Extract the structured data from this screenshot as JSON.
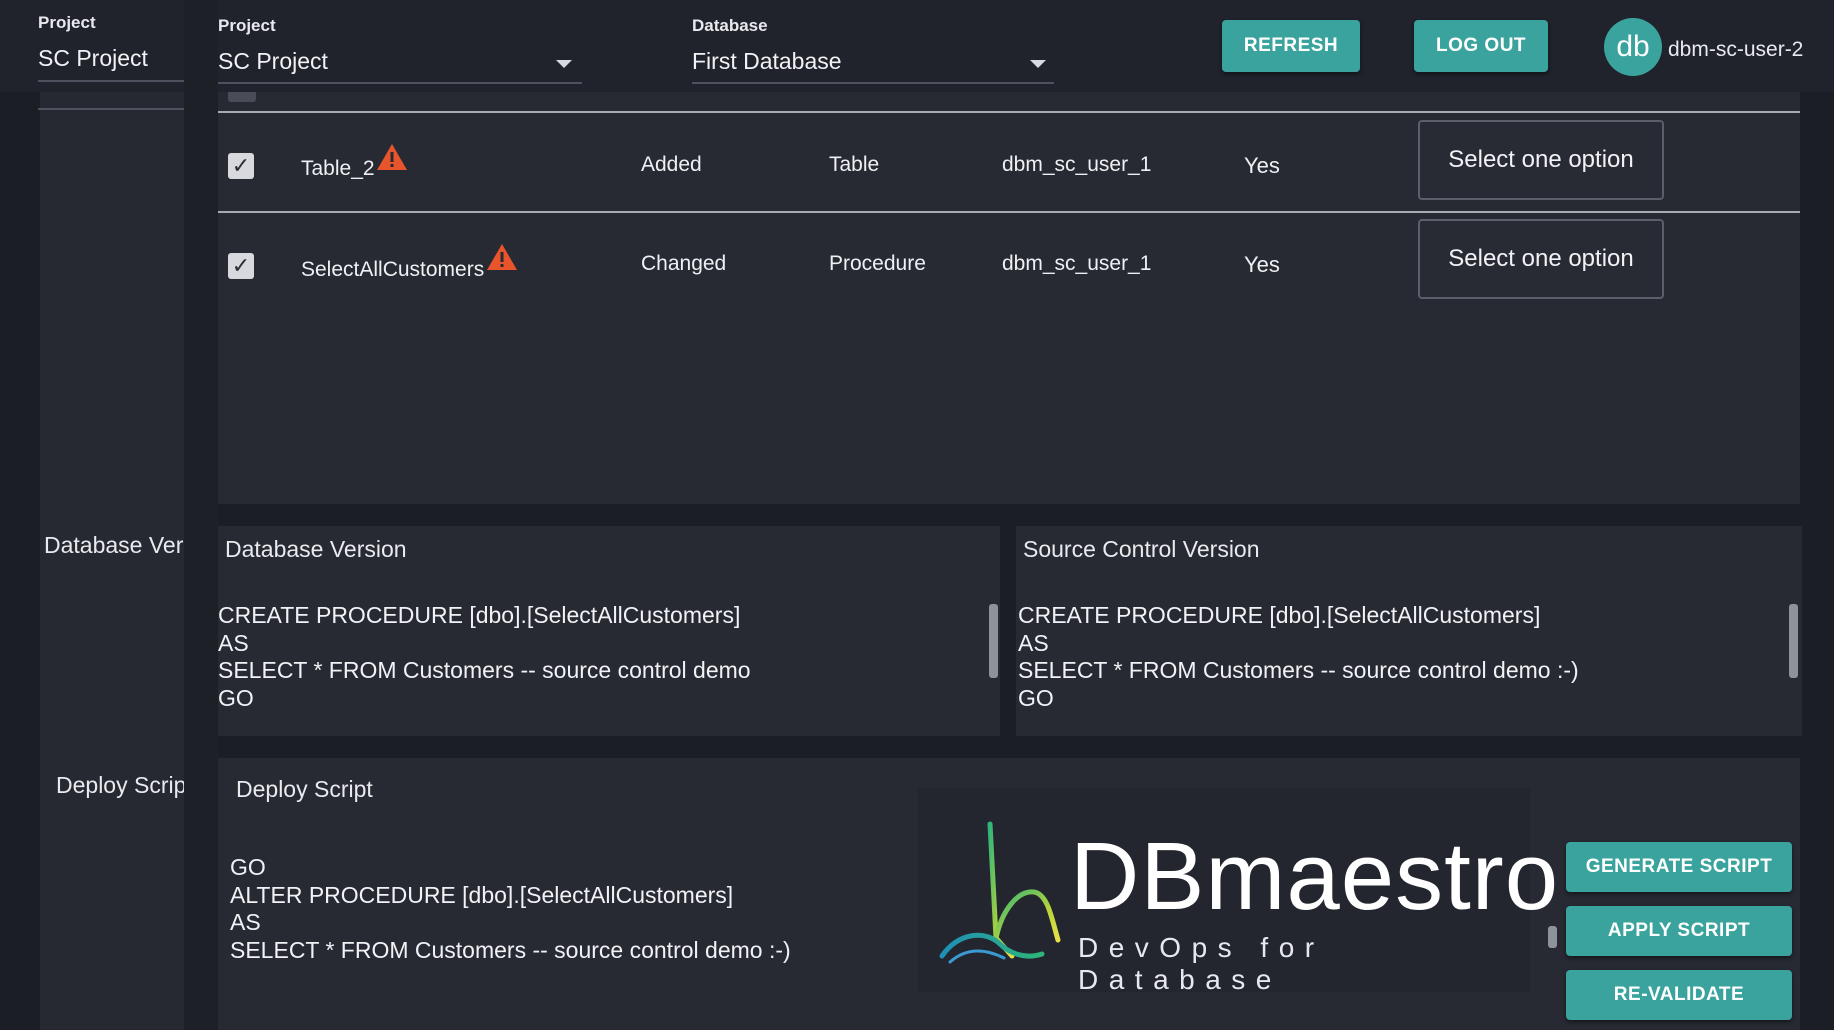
{
  "header": {
    "sidebar_project_label": "Project",
    "sidebar_project_value": "SC Project",
    "project_label": "Project",
    "project_value": "SC Project",
    "database_label": "Database",
    "database_value": "First Database",
    "refresh_label": "REFRESH",
    "logout_label": "LOG OUT",
    "avatar_initials": "db",
    "username": "dbm-sc-user-2"
  },
  "sidebar": {
    "db_version_label": "Database Ver",
    "deploy_script_label": "Deploy Scrip"
  },
  "table": {
    "rows": [
      {
        "checked": "✓",
        "object_name": "Table_2",
        "change_type": "Added",
        "object_type": "Table",
        "changed_by": "dbm_sc_user_1",
        "to_commit": "Yes",
        "resolution": "Select one option"
      },
      {
        "checked": "✓",
        "object_name": "SelectAllCustomers",
        "change_type": "Changed",
        "object_type": "Procedure",
        "changed_by": "dbm_sc_user_1",
        "to_commit": "Yes",
        "resolution": "Select one option"
      }
    ]
  },
  "database_version": {
    "title": "Database Version",
    "lines": [
      "CREATE PROCEDURE [dbo].[SelectAllCustomers]",
      "AS",
      "SELECT * FROM Customers -- source control demo",
      "GO"
    ]
  },
  "source_control_version": {
    "title": "Source Control Version",
    "lines": [
      "CREATE PROCEDURE [dbo].[SelectAllCustomers]",
      "AS",
      "SELECT * FROM Customers -- source control demo :-)",
      "GO"
    ]
  },
  "deploy_script": {
    "title": "Deploy Script",
    "lines": [
      "GO",
      "ALTER PROCEDURE [dbo].[SelectAllCustomers]",
      "AS",
      "SELECT * FROM Customers -- source control demo :-)"
    ],
    "generate_label": "GENERATE SCRIPT",
    "apply_label": "APPLY SCRIPT",
    "revalidate_label": "RE-VALIDATE"
  },
  "logo": {
    "title": "DBmaestro",
    "subtitle": "DevOps for Database"
  },
  "colors": {
    "accent": "#3aa39e",
    "warning": "#e8542c",
    "background": "#1c1e26",
    "panel": "#272a33"
  }
}
